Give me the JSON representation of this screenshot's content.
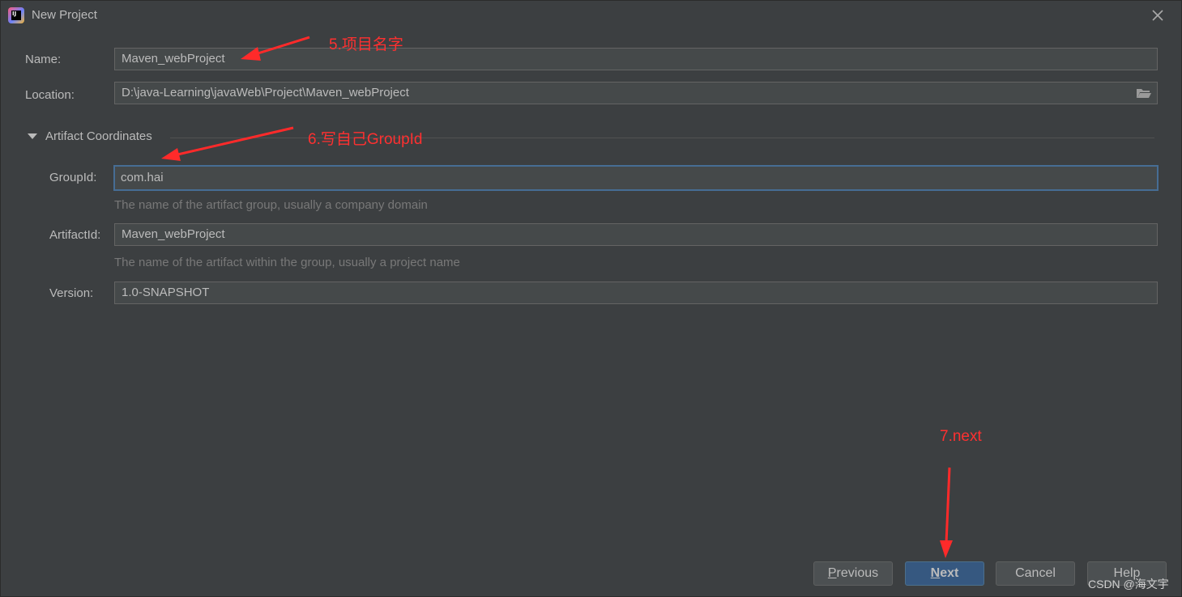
{
  "window": {
    "title": "New Project",
    "app_icon_text": "IJ"
  },
  "form": {
    "name_label": "Name:",
    "name_value": "Maven_webProject",
    "location_label": "Location:",
    "location_value": "D:\\java-Learning\\javaWeb\\Project\\Maven_webProject",
    "section_title": "Artifact Coordinates",
    "groupid_label": "GroupId:",
    "groupid_value": "com.hai",
    "groupid_hint": "The name of the artifact group, usually a company domain",
    "artifactid_label": "ArtifactId:",
    "artifactid_value": "Maven_webProject",
    "artifactid_hint": "The name of the artifact within the group, usually a project name",
    "version_label": "Version:",
    "version_value": "1.0-SNAPSHOT"
  },
  "buttons": {
    "previous_first": "P",
    "previous_rest": "revious",
    "next_first": "N",
    "next_rest": "ext",
    "cancel": "Cancel",
    "help": "Help"
  },
  "annotations": {
    "step5": "5.项目名字",
    "step6": "6.写自己GroupId",
    "step7": "7.next",
    "color": "#ff3030"
  },
  "watermark": "CSDN @海文宇",
  "colors": {
    "background": "#3c3f41",
    "field": "#45494a",
    "focus_border": "#466d94",
    "primary_button": "#365880"
  }
}
